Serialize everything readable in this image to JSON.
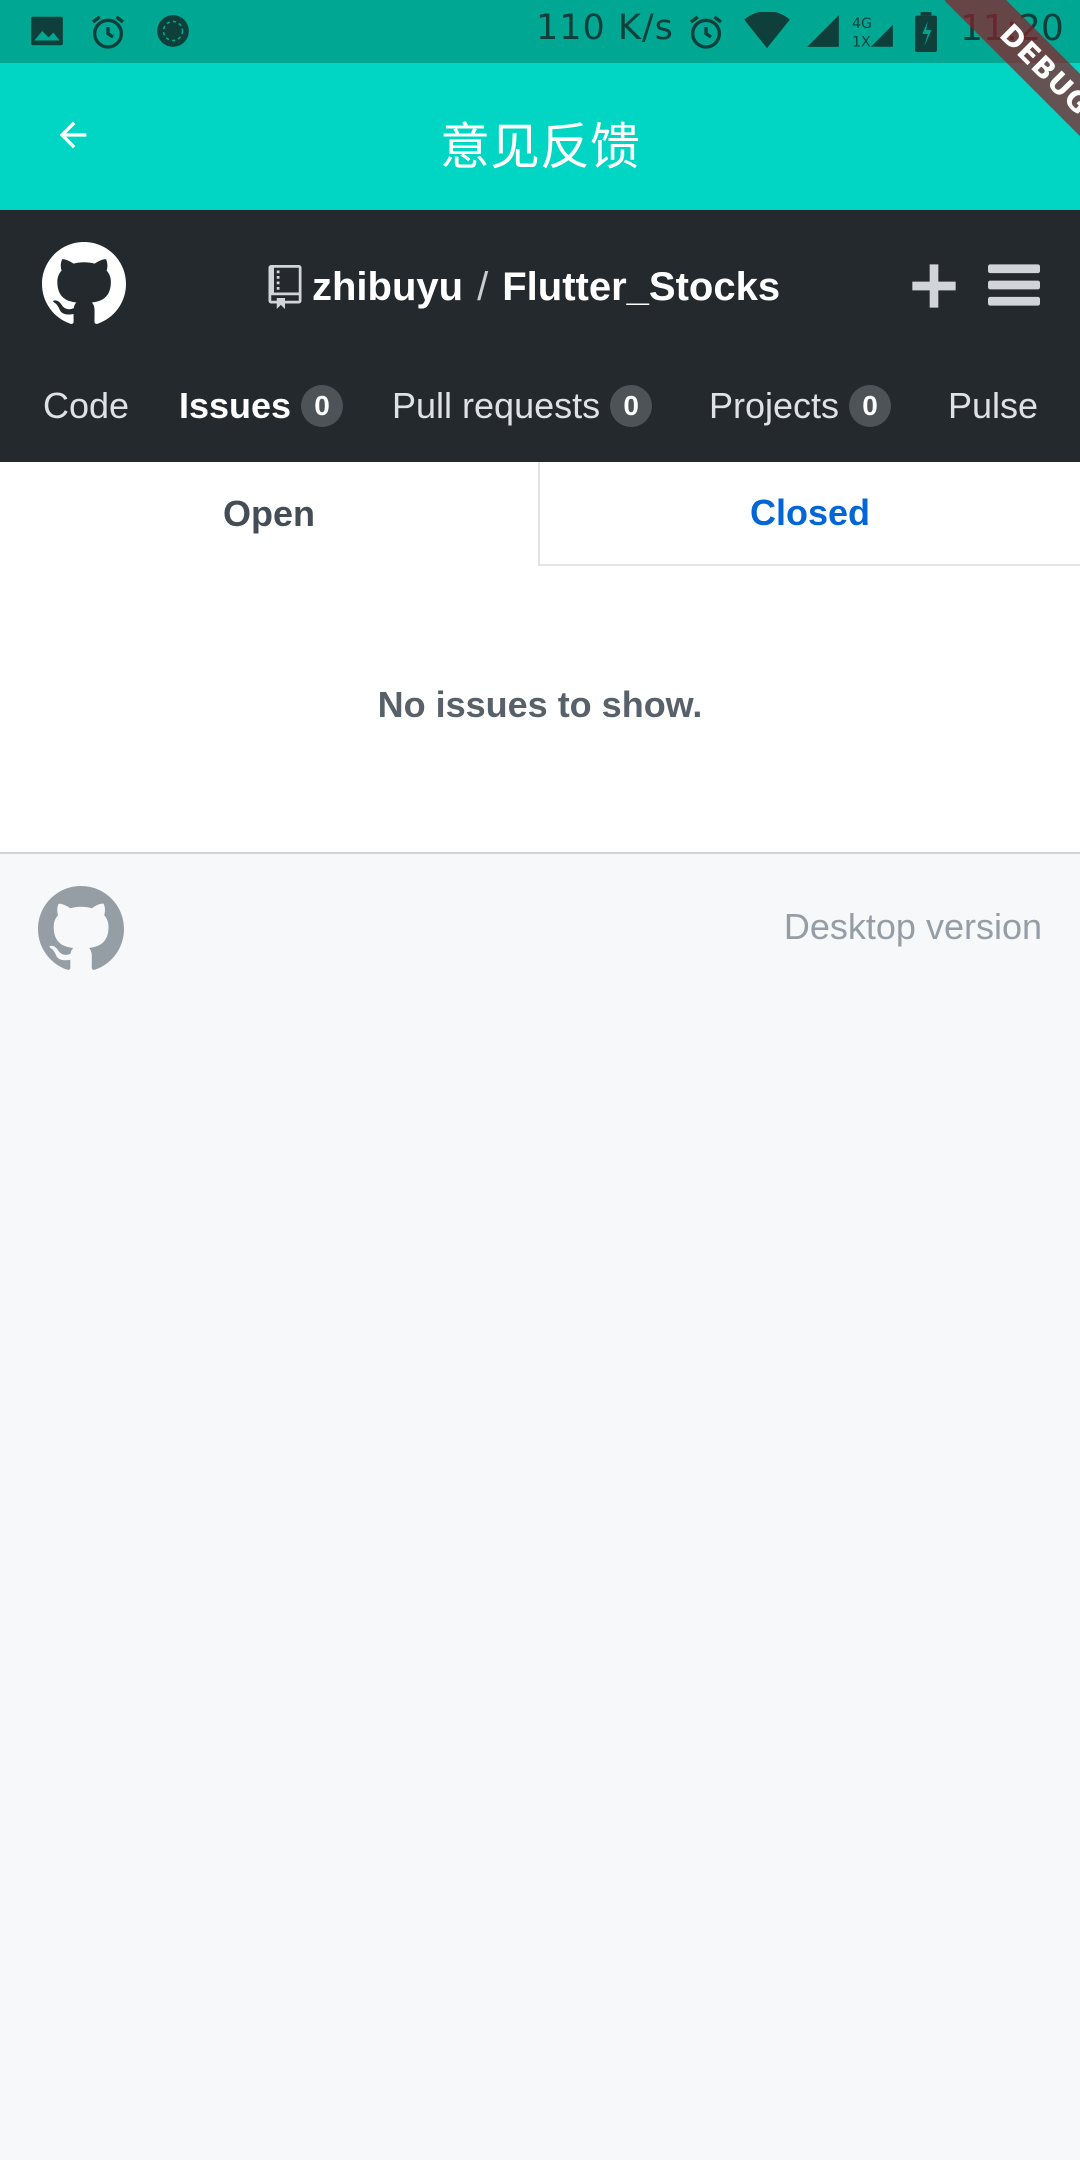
{
  "status_bar": {
    "network_speed": "110 K/s",
    "time": "11:20",
    "icons": [
      "gallery-icon",
      "alarm-icon",
      "app-notification-icon",
      "alarm-icon",
      "wifi-icon",
      "cellular-signal-icon",
      "network-4g-icon",
      "battery-icon"
    ]
  },
  "app_bar": {
    "title": "意见反馈",
    "back_icon": "arrow-left-icon"
  },
  "debug_banner": {
    "label": "DEBUG"
  },
  "github_header": {
    "logo_icon": "github-octocat-icon",
    "repo_icon": "repo-book-icon",
    "owner": "zhibuyu",
    "separator": "/",
    "repo": "Flutter_Stocks",
    "add_icon": "plus-icon",
    "menu_icon": "hamburger-menu-icon"
  },
  "reponav": {
    "items": [
      {
        "label": "Code",
        "selected": false
      },
      {
        "label": "Issues",
        "count": "0",
        "selected": true
      },
      {
        "label": "Pull requests",
        "count": "0",
        "selected": false
      },
      {
        "label": "Projects",
        "count": "0",
        "selected": false
      },
      {
        "label": "Pulse",
        "selected": false
      }
    ]
  },
  "state_tabs": {
    "open": "Open",
    "closed": "Closed",
    "active": "closed"
  },
  "blank_slate": {
    "message": "No issues to show."
  },
  "footer": {
    "logo_icon": "github-octocat-icon",
    "desktop_link": "Desktop version"
  },
  "colors": {
    "status_bar": "#00a894",
    "app_bar": "#00d6c3",
    "header_dark": "#24292e",
    "link_blue": "#0366d6",
    "page_bg": "#f6f8fa"
  }
}
